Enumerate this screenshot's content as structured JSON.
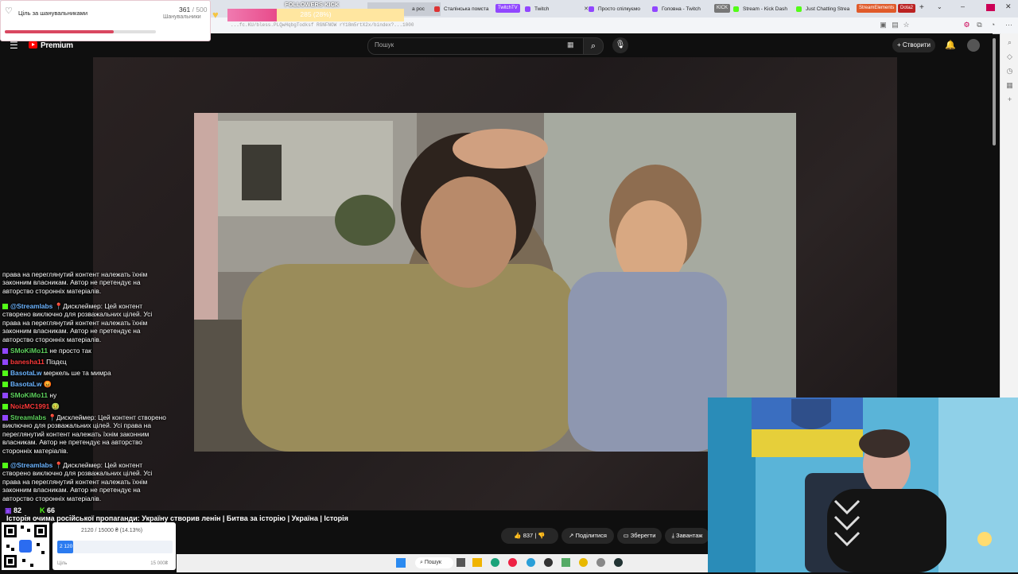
{
  "browser": {
    "tabs": [
      {
        "label": "Сталінська помста",
        "color": "#d33"
      },
      {
        "label": "TwitchTV",
        "color": "#9146ff",
        "is_badge": true
      },
      {
        "label": "Twitch",
        "color": "#9146ff"
      },
      {
        "label": "Просто спілкуємо",
        "color": "#9146ff"
      },
      {
        "label": "Головна - Twitch",
        "color": "#9146ff"
      },
      {
        "label": "KICK",
        "color": "#53fc18",
        "is_badge": true
      },
      {
        "label": "Stream - Kick Dash",
        "color": "#53fc18"
      },
      {
        "label": "Just Chatting Strea",
        "color": "#53fc18"
      }
    ],
    "badges": [
      {
        "label": "StreamElements",
        "color": "#e05a2a"
      },
      {
        "label": "Dota2",
        "color": "#b22"
      }
    ],
    "partial_tab": "а рос",
    "new_tab": "+",
    "url": "...fc.KU/bless.PLQwHqbgTodksf RGNFNOW rY18m5rtX2x/bindex?...1000"
  },
  "youtube": {
    "logo": "Premium",
    "search_placeholder": "Пошук",
    "create_label": "Створити",
    "video_title": "Історія очима російської пропаганди: Україну створив ленін | Битва за історію | Україна | Історія",
    "actions": {
      "likes": "837",
      "share": "Поділитися",
      "save": "Зберегти",
      "download": "Завантаж"
    },
    "colors": {
      "accent": "#ff0000",
      "background": "#0f0f0f"
    }
  },
  "goal_widget": {
    "title": "Ціль за шанувальниками",
    "current": "361",
    "target": "500",
    "separator": "/",
    "sub_label": "Шанувальники",
    "progress": 0.722
  },
  "kick_widget": {
    "title": "FOLLOWERS KICK",
    "value_label": "285 (28%)",
    "progress": 0.28
  },
  "chat": {
    "messages": [
      {
        "platform": "",
        "name": "",
        "text": "права на переглянутий контент належать їхнім законним власникам. Автор не претендує на авторство сторонніх матеріалів.",
        "name_color": "#fff"
      },
      {
        "platform": "kick",
        "name": "@Streamlabs",
        "text": "📍Дисклеймер: Цей контент створено виключно для розважальних цілей. Усі права на переглянутий контент належать їхнім законним власникам. Автор не претендує на авторство сторонніх матеріалів.",
        "name_color": "#6cb4ff"
      },
      {
        "platform": "twitch",
        "name": "SMoKiMo11",
        "text": "не просто так",
        "name_color": "#5fd35f"
      },
      {
        "platform": "twitch",
        "name": "banesha11",
        "text": "Піздєц",
        "name_color": "#ff3b3b"
      },
      {
        "platform": "kick",
        "name": "BasotaLw",
        "text": "меркель ше та мимра",
        "name_color": "#6cb4ff"
      },
      {
        "platform": "kick",
        "name": "BasotaLw",
        "text": "😡",
        "name_color": "#6cb4ff"
      },
      {
        "platform": "twitch",
        "name": "SMoKiMo11",
        "text": "ну",
        "name_color": "#5fd35f"
      },
      {
        "platform": "kick",
        "name": "NoizMC1991",
        "text": "🤢",
        "name_color": "#ff3b3b"
      },
      {
        "platform": "twitch",
        "name": "Streamlabs",
        "text": "📍Дисклеймер: Цей контент створено виключно для розважальних цілей. Усі права на переглянутий контент належать їхнім законним власникам. Автор не претендує на авторство сторонніх матеріалів.",
        "name_color": "#5fd35f"
      },
      {
        "platform": "kick",
        "name": "@Streamlabs",
        "text": "📍Дисклеймер: Цей контент створено виключно для розважальних цілей. Усі права на переглянутий контент належать їхнім законним власникам. Автор не претендує на авторство сторонніх матеріалів.",
        "name_color": "#6cb4ff"
      }
    ],
    "viewers": {
      "twitch": "82",
      "kick": "66"
    }
  },
  "donation": {
    "text": "2120 / 15000 ₴ (14.13%)",
    "bar_label": "2 120",
    "goal_label": "Ціль",
    "goal_value": "15 000₴",
    "progress": 0.1413
  },
  "taskbar": {
    "search_label": "Пошук"
  }
}
